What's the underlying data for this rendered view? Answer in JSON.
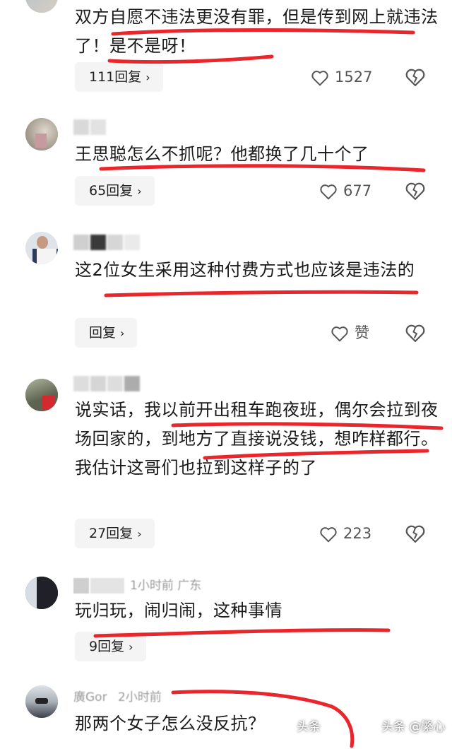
{
  "comments": [
    {
      "author_blurred": "",
      "meta": "",
      "text": "双方自愿不违法更没有罪，但是传到网上就违法了！是不是呀！",
      "reply_label": "111回复",
      "likes": "1527"
    },
    {
      "author_blurred": "",
      "meta": "",
      "text": "王思聪怎么不抓呢？他都换了几十个了",
      "reply_label": "65回复",
      "likes": "677"
    },
    {
      "author_blurred": "",
      "meta": "",
      "text": "这2位女生采用这种付费方式也应该是违法的",
      "reply_label": "回复",
      "likes": "赞"
    },
    {
      "author_blurred": "",
      "meta": "",
      "text": "说实话，我以前开出租车跑夜班，偶尔会拉到夜场回家的，到地方了直接说没钱，想咋样都行。我估计这哥们也拉到这样子的了",
      "reply_label": "27回复",
      "likes": "223"
    },
    {
      "author_blurred": "",
      "meta": "1小时前 广东",
      "text": "玩归玩，闹归闹，这种事情",
      "reply_label": "9回复",
      "likes": ""
    },
    {
      "author_blurred": "",
      "meta_name": "廣Gor",
      "meta": "2小时前",
      "text": "那两个女子怎么没反抗？",
      "reply_label": "",
      "likes": ""
    }
  ],
  "icons": {
    "chevron": "›",
    "like": "heart-outline-icon",
    "dislike": "broken-heart-icon"
  },
  "watermarks": {
    "left": "头条",
    "right": "头条 @繁心"
  },
  "colors": {
    "underline": "#e8262b",
    "reply_bg": "#f4f4f4",
    "meta_text": "#9a9a9a"
  }
}
